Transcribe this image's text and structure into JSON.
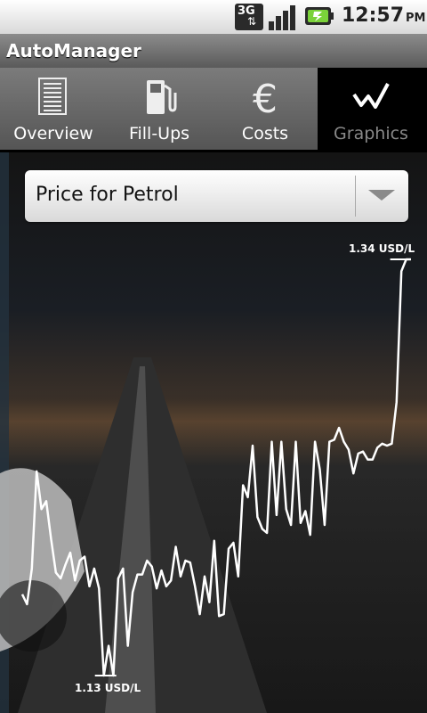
{
  "status_bar": {
    "network": "3G",
    "time": "12:57",
    "ampm": "PM",
    "icons": [
      "network-3g-icon",
      "signal-icon",
      "battery-charging-icon"
    ]
  },
  "app": {
    "title": "AutoManager"
  },
  "tabs": [
    {
      "label": "Overview",
      "icon": "list-icon",
      "selected": false
    },
    {
      "label": "Fill-Ups",
      "icon": "fuel-pump-icon",
      "selected": false
    },
    {
      "label": "Costs",
      "icon": "euro-icon",
      "selected": false
    },
    {
      "label": "Graphics",
      "icon": "line-graph-icon",
      "selected": true
    }
  ],
  "selector": {
    "value": "Price for Petrol"
  },
  "chart_data": {
    "type": "line",
    "max_label": "1.34 USD/L",
    "min_label": "1.13 USD/L",
    "ylim": [
      1.13,
      1.34
    ],
    "values": [
      1.171,
      1.166,
      1.184,
      1.233,
      1.214,
      1.218,
      1.199,
      1.182,
      1.179,
      1.186,
      1.192,
      1.178,
      1.188,
      1.19,
      1.175,
      1.184,
      1.174,
      1.13,
      1.145,
      1.13,
      1.179,
      1.184,
      1.145,
      1.172,
      1.181,
      1.181,
      1.188,
      1.185,
      1.174,
      1.183,
      1.175,
      1.178,
      1.195,
      1.18,
      1.188,
      1.187,
      1.175,
      1.161,
      1.18,
      1.167,
      1.198,
      1.16,
      1.161,
      1.194,
      1.197,
      1.18,
      1.226,
      1.22,
      1.246,
      1.21,
      1.204,
      1.202,
      1.248,
      1.211,
      1.248,
      1.214,
      1.206,
      1.248,
      1.207,
      1.213,
      1.201,
      1.248,
      1.234,
      1.206,
      1.248,
      1.249,
      1.255,
      1.248,
      1.244,
      1.232,
      1.242,
      1.243,
      1.239,
      1.239,
      1.245,
      1.247,
      1.246,
      1.247,
      1.268,
      1.334,
      1.34,
      1.34
    ]
  }
}
